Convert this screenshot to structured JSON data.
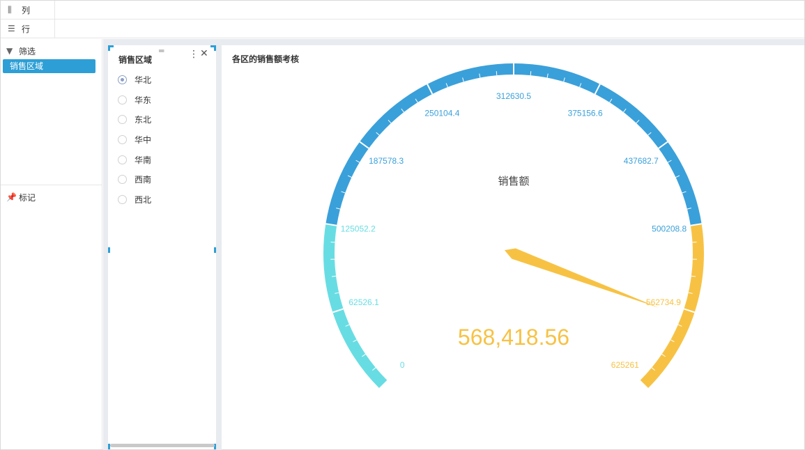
{
  "shelves": {
    "columns": {
      "label": "列",
      "icon": "columns-icon"
    },
    "rows": {
      "label": "行",
      "icon": "list-icon"
    }
  },
  "left_panel": {
    "filter": {
      "label": "筛选",
      "icon": "funnel-icon",
      "fields": [
        "销售区域"
      ]
    },
    "marks": {
      "label": "标记",
      "icon": "pin-icon"
    }
  },
  "filter_card": {
    "title": "销售区域",
    "options": [
      {
        "label": "华北",
        "selected": true
      },
      {
        "label": "华东",
        "selected": false
      },
      {
        "label": "东北",
        "selected": false
      },
      {
        "label": "华中",
        "selected": false
      },
      {
        "label": "华南",
        "selected": false
      },
      {
        "label": "西南",
        "selected": false
      },
      {
        "label": "西北",
        "selected": false
      }
    ]
  },
  "chart": {
    "title": "各区的销售额考核",
    "colors": {
      "blue": "#3aa0da",
      "cyan": "#67dde3",
      "yellow": "#f7c244"
    }
  },
  "chart_data": {
    "type": "gauge",
    "title": "各区的销售额考核",
    "label": "销售额",
    "value": 568418.56,
    "value_display": "568,418.56",
    "min": 0,
    "max": 625261,
    "ticks": [
      "0",
      "62526.1",
      "125052.2",
      "187578.3",
      "250104.4",
      "312630.5",
      "375156.6",
      "437682.7",
      "500208.8",
      "562734.9",
      "625261"
    ],
    "tick_values": [
      0,
      62526.1,
      125052.2,
      187578.3,
      250104.4,
      312630.5,
      375156.6,
      437682.7,
      500208.8,
      562734.9,
      625261
    ],
    "bands": [
      {
        "from": 0,
        "to": 125052.2,
        "color": "#67dde3"
      },
      {
        "from": 125052.2,
        "to": 500208.8,
        "color": "#3aa0da"
      },
      {
        "from": 500208.8,
        "to": 625261,
        "color": "#f7c244"
      }
    ]
  }
}
